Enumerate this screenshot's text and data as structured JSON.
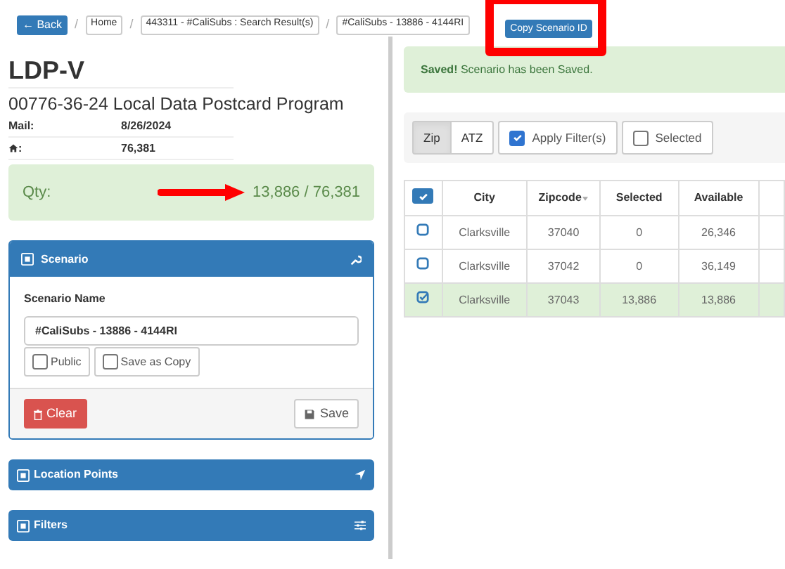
{
  "breadcrumbs": [
    {
      "kind": "button",
      "label": "← Back"
    },
    {
      "kind": "crumb",
      "label": "Home"
    },
    {
      "kind": "crumb",
      "label": "443311 - #CaliSubs : Search Result(s)"
    },
    {
      "kind": "crumb",
      "label": "#CaliSubs - 13886 - 4144RI"
    }
  ],
  "separator": "/",
  "copy_button": {
    "label": "Copy Scenario ID",
    "highlighted": true
  },
  "program": {
    "title": "LDP-V",
    "subtitle": "00776-36-24 Local Data Postcard Program",
    "details": [
      {
        "kind": "text",
        "label": "Mail:",
        "value": "8/26/2024"
      },
      {
        "kind": "home",
        "label": ":",
        "value": "76,381"
      }
    ]
  },
  "qty": {
    "label": "Qty:",
    "value": "13,886 / 76,381",
    "arrow": true
  },
  "scenario": {
    "title": "Scenario",
    "expanded": true,
    "field_label": "Scenario Name",
    "field_value": "#CaliSubs - 13886 - 4144RI",
    "options": [
      {
        "label": "Public",
        "checked": false
      },
      {
        "label": "Save as Copy",
        "checked": false
      }
    ],
    "clear_label": "Clear",
    "save_label": "Save"
  },
  "panels": [
    {
      "kind": "location",
      "title": "Location Points",
      "expanded": false
    },
    {
      "kind": "filters",
      "title": "Filters",
      "expanded": false
    }
  ],
  "alert": "**Saved!** Scenario has been Saved.",
  "toolbar": {
    "modes": [
      {
        "label": "Zip",
        "selected": true
      },
      {
        "label": "ATZ",
        "selected": false
      }
    ],
    "options": [
      {
        "label": "Apply Filter(s)",
        "checked": true
      },
      {
        "label": "Selected",
        "checked": false
      }
    ]
  },
  "table": {
    "select_all": true,
    "columns": [
      "City",
      "Zipcode",
      "Selected",
      "Available"
    ],
    "rows": [
      {
        "checked": false,
        "cells": [
          "Clarksville",
          "37040",
          "0",
          "26,346"
        ]
      },
      {
        "checked": false,
        "cells": [
          "Clarksville",
          "37042",
          "0",
          "36,149"
        ]
      },
      {
        "checked": true,
        "cells": [
          "Clarksville",
          "37043",
          "13,886",
          "13,886"
        ]
      }
    ]
  }
}
